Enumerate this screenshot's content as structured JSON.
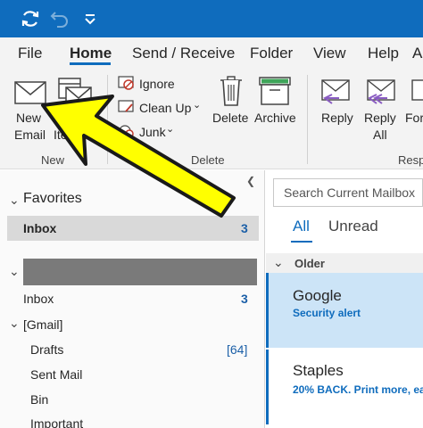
{
  "title_bar": {
    "icons": [
      "sync-icon",
      "undo-icon",
      "customize-toolbar-icon"
    ]
  },
  "menu": {
    "tabs": [
      "File",
      "Home",
      "Send / Receive",
      "Folder",
      "View",
      "Help",
      "Ad"
    ],
    "active": "Home"
  },
  "ribbon": {
    "new_group": {
      "new_email_line1": "New",
      "new_email_line2": "Email",
      "new_items_label": "Ite",
      "group_label": "New"
    },
    "delete_group": {
      "ignore": "Ignore",
      "clean_up": "Clean Up",
      "junk": "Junk",
      "delete": "Delete",
      "archive": "Archive",
      "group_label": "Delete"
    },
    "respond_group": {
      "reply": "Reply",
      "reply_all_line1": "Reply",
      "reply_all_line2": "All",
      "forward": "For",
      "group_label": "Resp"
    }
  },
  "folders": {
    "favorites_label": "Favorites",
    "favorites_inbox": "Inbox",
    "favorites_inbox_count": "3",
    "inbox": "Inbox",
    "inbox_count": "3",
    "gmail": "[Gmail]",
    "drafts": "Drafts",
    "drafts_count": "[64]",
    "sent_mail": "Sent Mail",
    "bin": "Bin",
    "important": "Important"
  },
  "message_list": {
    "search_placeholder": "Search Current Mailbox",
    "filter_all": "All",
    "filter_unread": "Unread",
    "group_header": "Older",
    "messages": [
      {
        "sender": "Google",
        "subject": "Security alert"
      },
      {
        "sender": "Staples",
        "subject": "20% BACK. Print more, ea"
      }
    ]
  },
  "colors": {
    "accent": "#0f6cbd",
    "annotation_arrow": "#ffff00"
  }
}
